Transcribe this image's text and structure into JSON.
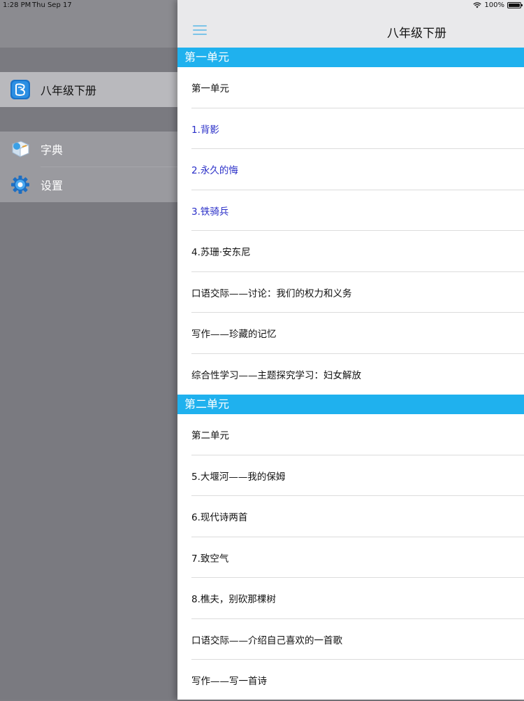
{
  "status_bar": {
    "time": "1:28 PM",
    "date": "Thu Sep 17",
    "battery": "100%"
  },
  "sidebar": {
    "items": [
      {
        "label": "八年级下册",
        "icon": "book-icon",
        "selected": true
      },
      {
        "label": "字典",
        "icon": "dictionary-icon"
      },
      {
        "label": "设置",
        "icon": "gear-icon"
      }
    ]
  },
  "nav": {
    "title": "八年级下册",
    "menu_icon": "hamburger-menu-icon"
  },
  "colors": {
    "section_header": "#1fb1ee",
    "link": "#2a2fc8",
    "menu_icon": "#7cc4e8"
  },
  "sections": [
    {
      "header": "第一单元",
      "rows": [
        {
          "text": "第一单元",
          "link": false
        },
        {
          "text": "1.背影",
          "link": true
        },
        {
          "text": "2.永久的悔",
          "link": true
        },
        {
          "text": "3.铁骑兵",
          "link": true
        },
        {
          "text": "4.苏珊·安东尼",
          "link": false
        },
        {
          "text": "口语交际——讨论：我们的权力和义务",
          "link": false
        },
        {
          "text": "写作——珍藏的记忆",
          "link": false
        },
        {
          "text": "综合性学习——主题探究学习：妇女解放",
          "link": false
        }
      ]
    },
    {
      "header": "第二单元",
      "rows": [
        {
          "text": "第二单元",
          "link": false
        },
        {
          "text": "5.大堰河——我的保姆",
          "link": false
        },
        {
          "text": "6.现代诗两首",
          "link": false
        },
        {
          "text": "7.致空气",
          "link": false
        },
        {
          "text": "8.樵夫，别砍那棵树",
          "link": false
        },
        {
          "text": "口语交际——介绍自己喜欢的一首歌",
          "link": false
        },
        {
          "text": "写作——写一首诗",
          "link": false
        }
      ]
    }
  ]
}
